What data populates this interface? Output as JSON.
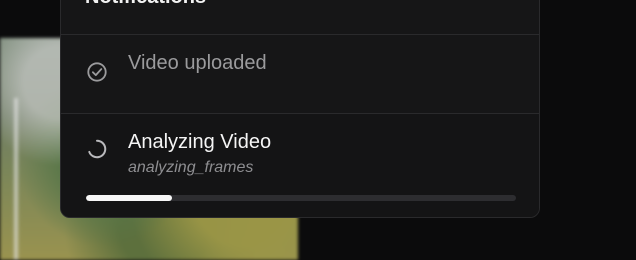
{
  "header": {
    "title": "Notifications"
  },
  "notifications": [
    {
      "state": "completed",
      "icon": "check-circle-icon",
      "title": "Video uploaded"
    },
    {
      "state": "in_progress",
      "icon": "loading-spinner-icon",
      "title": "Analyzing Video",
      "subtitle": "analyzing_frames",
      "progress": 0.2
    }
  ],
  "colors": {
    "background": "#0b0b0c",
    "panel": "#161617",
    "border": "#2a2a2c",
    "text_primary": "#f5f5f5",
    "text_secondary": "#9b9b9d",
    "progress_fill": "#f7f7f7",
    "progress_track": "#2d2d30"
  }
}
